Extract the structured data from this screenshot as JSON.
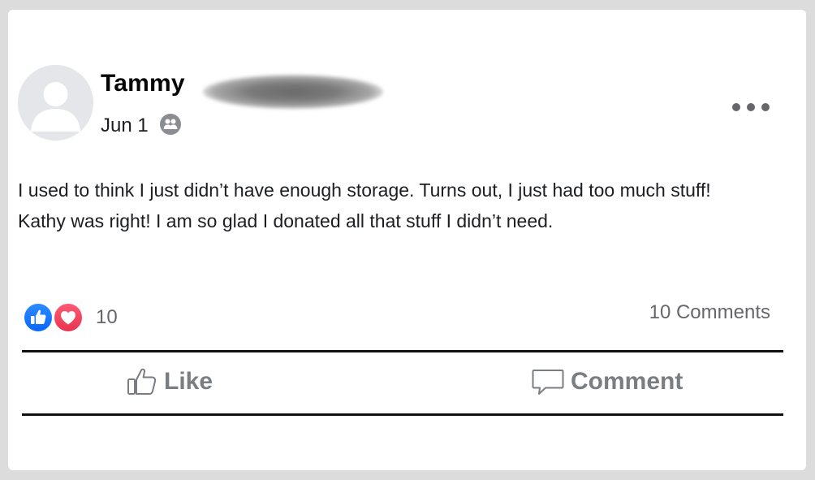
{
  "post": {
    "author_name": "Tammy",
    "date": "Jun 1",
    "audience_icon": "friends-icon",
    "text_line_1": "I used to think I just didn’t have enough storage. Turns out, I just had too much stuff!",
    "text_line_2": "Kathy was right! I am so glad I donated all that stuff I didn’t need."
  },
  "reactions": {
    "types": [
      "like",
      "love"
    ],
    "count": "10",
    "like_color": "#1877f2",
    "love_color": "#f0284a"
  },
  "comments": {
    "count_label": "10 Comments"
  },
  "actions": {
    "like_label": "Like",
    "comment_label": "Comment"
  },
  "colors": {
    "background": "#dcdcdc",
    "card": "#ffffff",
    "muted_text": "#65676b",
    "action_text": "#7a7d82"
  }
}
